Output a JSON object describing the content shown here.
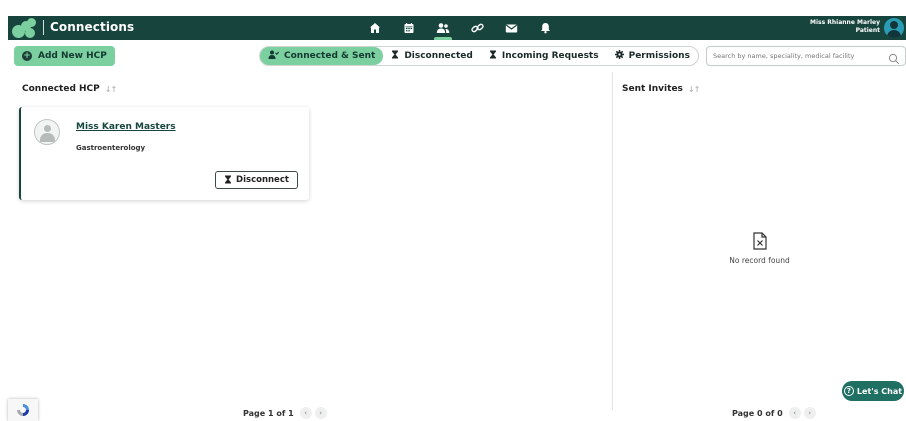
{
  "header": {
    "app_title": "Connections",
    "nav": [
      {
        "name": "home-icon",
        "active": false
      },
      {
        "name": "calendar-icon",
        "active": false
      },
      {
        "name": "people-icon",
        "active": true
      },
      {
        "name": "link-icon",
        "active": false
      },
      {
        "name": "mail-icon",
        "active": false
      },
      {
        "name": "bell-icon",
        "active": false
      }
    ],
    "user_name": "Miss Rhianne Marley",
    "user_role": "Patient"
  },
  "toolbar": {
    "add_label": "Add New HCP",
    "tabs": [
      {
        "label": "Connected & Sent",
        "icon": "user-check-icon",
        "active": true
      },
      {
        "label": "Disconnected",
        "icon": "hourglass-icon",
        "active": false
      },
      {
        "label": "Incoming Requests",
        "icon": "hourglass-icon",
        "active": false
      },
      {
        "label": "Permissions",
        "icon": "gear-icon",
        "active": false
      }
    ],
    "search_placeholder": "Search by name, speciality, medical facility"
  },
  "connected": {
    "title": "Connected HCP",
    "cards": [
      {
        "name": "Miss Karen Masters",
        "speciality": "Gastroenterology",
        "action_label": "Disconnect"
      }
    ],
    "pager": "Page 1 of 1"
  },
  "sent": {
    "title": "Sent Invites",
    "empty_text": "No record found",
    "pager": "Page 0 of 0"
  },
  "chat": {
    "label": "Let's Chat"
  },
  "colors": {
    "primary": "#17453e",
    "accent": "#7ccf9f"
  }
}
